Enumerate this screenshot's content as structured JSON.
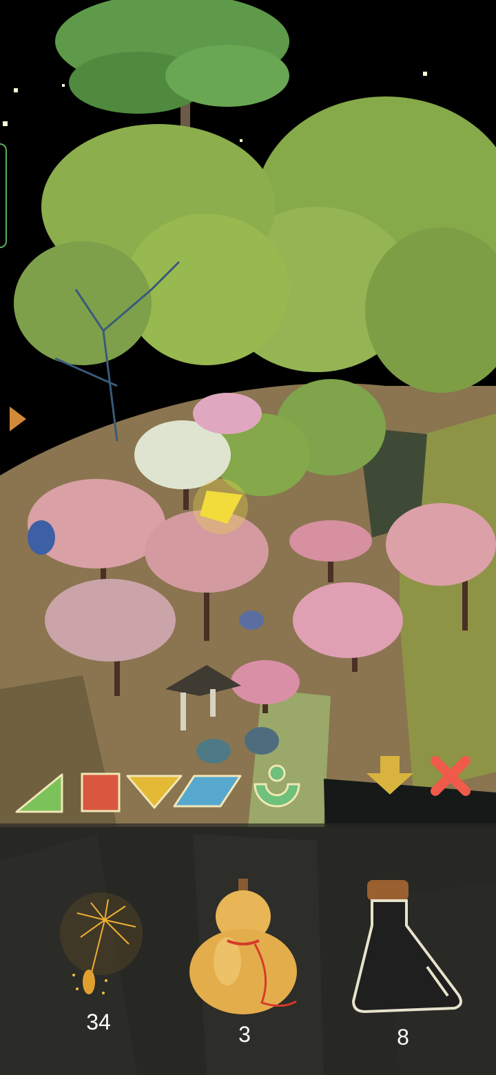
{
  "inventory": {
    "seed_count": "34",
    "gourd_count": "3",
    "bottle_count": "8"
  },
  "toolbar": {
    "shapes": [
      "triangle",
      "square",
      "down-triangle",
      "parallelogram",
      "sprout"
    ],
    "actions": [
      "place-down",
      "cancel"
    ]
  },
  "colors": {
    "triangle": "#7cc25a",
    "square": "#d9573f",
    "down_triangle": "#e4b935",
    "parallelogram": "#57a8cf",
    "sprout": "#6ec07a",
    "arrow": "#d8b33e",
    "cancel": "#ef5a4a",
    "ground": "#8a7550",
    "cherry": "#d9a0a6",
    "foliage": "#8cae4c"
  }
}
